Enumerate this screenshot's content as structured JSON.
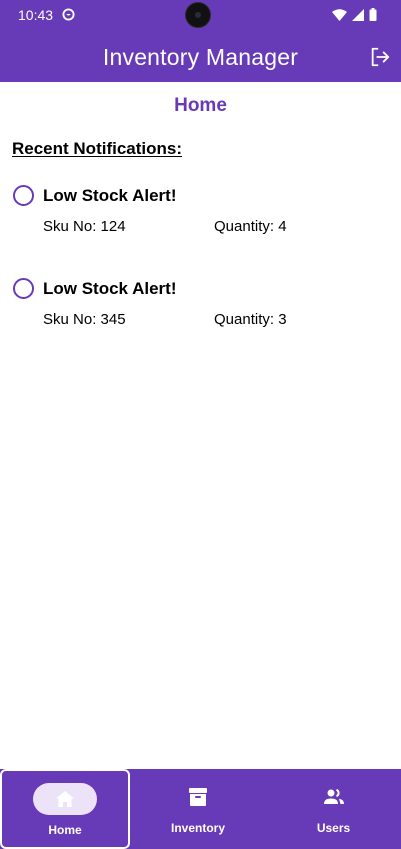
{
  "status_bar": {
    "time": "10:43"
  },
  "app_bar": {
    "title": "Inventory Manager"
  },
  "page": {
    "title": "Home",
    "section_heading": "Recent Notifications:"
  },
  "notifications": [
    {
      "title": "Low Stock Alert!",
      "sku": "Sku No: 124",
      "quantity": "Quantity: 4"
    },
    {
      "title": "Low Stock Alert!",
      "sku": "Sku No: 345",
      "quantity": "Quantity: 3"
    }
  ],
  "bottom_nav": {
    "items": [
      {
        "label": "Home",
        "icon": "home-icon",
        "active": true
      },
      {
        "label": "Inventory",
        "icon": "archive-box-icon",
        "active": false
      },
      {
        "label": "Users",
        "icon": "people-icon",
        "active": false
      }
    ]
  },
  "colors": {
    "primary": "#673ab7",
    "nav_indicator": "#ece3f8",
    "on_primary": "#ffffff"
  }
}
